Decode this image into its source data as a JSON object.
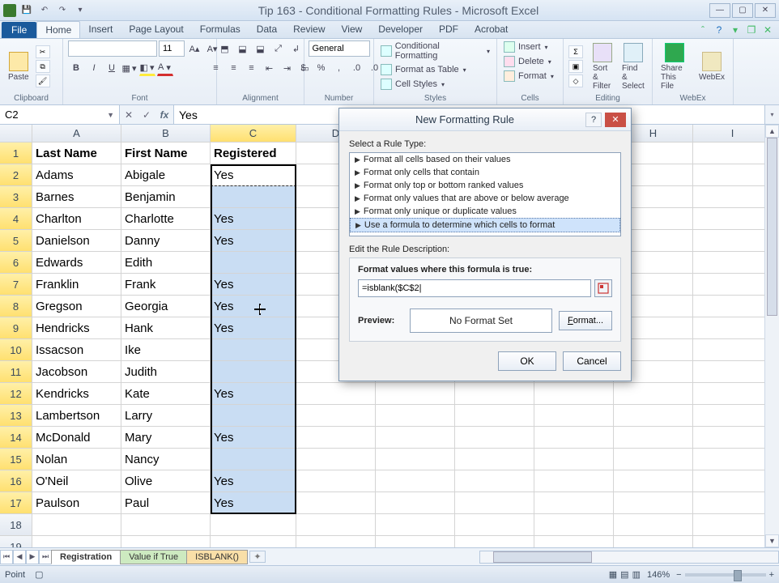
{
  "window": {
    "title": "Tip 163 - Conditional Formatting Rules - Microsoft Excel"
  },
  "tabs": {
    "file": "File",
    "items": [
      "Home",
      "Insert",
      "Page Layout",
      "Formulas",
      "Data",
      "Review",
      "View",
      "Developer",
      "PDF",
      "Acrobat"
    ],
    "active": 0
  },
  "ribbon": {
    "clipboard": {
      "paste": "Paste",
      "label": "Clipboard"
    },
    "font": {
      "size": "11",
      "label": "Font"
    },
    "align": {
      "label": "Alignment"
    },
    "number": {
      "format": "General",
      "label": "Number"
    },
    "styles": {
      "cf": "Conditional Formatting",
      "tbl": "Format as Table",
      "cs": "Cell Styles",
      "label": "Styles"
    },
    "cells": {
      "ins": "Insert",
      "del": "Delete",
      "fmt": "Format",
      "label": "Cells"
    },
    "editing": {
      "sort": "Sort & Filter",
      "find": "Find & Select",
      "label": "Editing"
    },
    "share": {
      "share": "Share This File",
      "webex": "WebEx",
      "label": "WebEx"
    }
  },
  "formula_bar": {
    "name": "C2",
    "value": "Yes"
  },
  "columns": [
    "A",
    "B",
    "C",
    "D",
    "E",
    "F",
    "G",
    "H",
    "I"
  ],
  "rows_count": 19,
  "data_rows": [
    {
      "r": 1,
      "a": "Last Name",
      "b": "First Name",
      "c": "Registered",
      "hdr": true
    },
    {
      "r": 2,
      "a": "Adams",
      "b": "Abigale",
      "c": "Yes"
    },
    {
      "r": 3,
      "a": "Barnes",
      "b": "Benjamin",
      "c": ""
    },
    {
      "r": 4,
      "a": "Charlton",
      "b": "Charlotte",
      "c": "Yes"
    },
    {
      "r": 5,
      "a": "Danielson",
      "b": "Danny",
      "c": "Yes"
    },
    {
      "r": 6,
      "a": "Edwards",
      "b": "Edith",
      "c": ""
    },
    {
      "r": 7,
      "a": "Franklin",
      "b": "Frank",
      "c": "Yes"
    },
    {
      "r": 8,
      "a": "Gregson",
      "b": "Georgia",
      "c": "Yes"
    },
    {
      "r": 9,
      "a": "Hendricks",
      "b": "Hank",
      "c": "Yes"
    },
    {
      "r": 10,
      "a": "Issacson",
      "b": "Ike",
      "c": ""
    },
    {
      "r": 11,
      "a": "Jacobson",
      "b": "Judith",
      "c": ""
    },
    {
      "r": 12,
      "a": "Kendricks",
      "b": "Kate",
      "c": "Yes"
    },
    {
      "r": 13,
      "a": "Lambertson",
      "b": "Larry",
      "c": ""
    },
    {
      "r": 14,
      "a": "McDonald",
      "b": "Mary",
      "c": "Yes"
    },
    {
      "r": 15,
      "a": "Nolan",
      "b": "Nancy",
      "c": ""
    },
    {
      "r": 16,
      "a": "O'Neil",
      "b": "Olive",
      "c": "Yes"
    },
    {
      "r": 17,
      "a": "Paulson",
      "b": "Paul",
      "c": "Yes"
    }
  ],
  "sheets": {
    "navs": [
      "⏮",
      "◀",
      "▶",
      "⏭"
    ],
    "tabs": [
      "Registration",
      "Value if True",
      "ISBLANK()"
    ],
    "active": 0
  },
  "status": {
    "mode": "Point",
    "zoom": "146%"
  },
  "dialog": {
    "title": "New Formatting Rule",
    "select_label": "Select a Rule Type:",
    "rules": [
      "Format all cells based on their values",
      "Format only cells that contain",
      "Format only top or bottom ranked values",
      "Format only values that are above or below average",
      "Format only unique or duplicate values",
      "Use a formula to determine which cells to format"
    ],
    "rules_selected": 5,
    "edit_label": "Edit the Rule Description:",
    "formula_label": "Format values where this formula is true:",
    "formula_value": "=isblank($C$2|",
    "preview_label": "Preview:",
    "preview_text": "No Format Set",
    "format_btn": "Format...",
    "ok": "OK",
    "cancel": "Cancel"
  }
}
